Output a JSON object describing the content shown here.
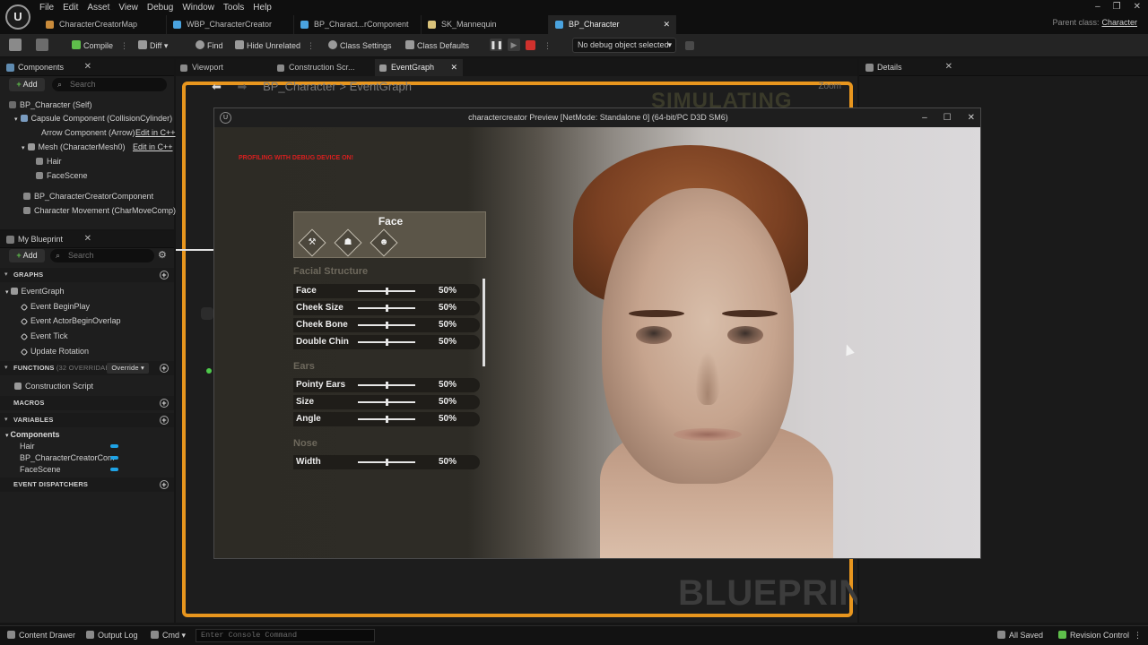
{
  "menu": [
    "File",
    "Edit",
    "Asset",
    "View",
    "Debug",
    "Window",
    "Tools",
    "Help"
  ],
  "app_logo": "U",
  "window_controls": [
    "–",
    "❐",
    "✕"
  ],
  "doc_tabs": [
    {
      "label": "CharacterCreatorMap",
      "color": "#c98b3b"
    },
    {
      "label": "WBP_CharacterCreator",
      "color": "#4aa3df"
    },
    {
      "label": "BP_Charact...rComponent",
      "color": "#4aa3df"
    },
    {
      "label": "SK_Mannequin",
      "color": "#d9c27a"
    },
    {
      "label": "BP_Character",
      "color": "#4aa3df"
    }
  ],
  "doc_tab_close": "✕",
  "parent_class": {
    "label": "Parent class:",
    "value": "Character"
  },
  "toolbar": {
    "compile": "Compile",
    "diff": "Diff",
    "find": "Find",
    "hide_unrelated": "Hide Unrelated",
    "class_settings": "Class Settings",
    "class_defaults": "Class Defaults",
    "debug_object": "No debug object selected"
  },
  "components_panel": {
    "title": "Components",
    "add": "Add",
    "search_placeholder": "Search",
    "items": [
      {
        "label": "BP_Character (Self)"
      },
      {
        "label": "Capsule Component (CollisionCylinder)"
      },
      {
        "label": "Arrow Component (Arrow)",
        "link": "Edit in C++"
      },
      {
        "label": "Mesh (CharacterMesh0)",
        "link": "Edit in C++"
      },
      {
        "label": "Hair"
      },
      {
        "label": "FaceScene"
      },
      {
        "label": "BP_CharacterCreatorComponent"
      },
      {
        "label": "Character Movement (CharMoveComp)"
      }
    ]
  },
  "my_blueprint": {
    "title": "My Blueprint",
    "add": "Add",
    "search_placeholder": "Search",
    "graphs_header": "GRAPHS",
    "graphs": [
      "EventGraph",
      "Event BeginPlay",
      "Event ActorBeginOverlap",
      "Event Tick",
      "Update Rotation"
    ],
    "functions_header": "FUNCTIONS",
    "functions_sub": "(32 OVERRIDABLE)",
    "override": "Override",
    "functions": [
      "Construction Script"
    ],
    "macros_header": "MACROS",
    "variables_header": "VARIABLES",
    "variables_group": "Components",
    "variables": [
      "Hair",
      "BP_CharacterCreatorCom",
      "FaceScene"
    ],
    "dispatchers_header": "EVENT DISPATCHERS"
  },
  "graph_tabs": [
    "Viewport",
    "Construction Scr...",
    "EventGraph"
  ],
  "breadcrumb": {
    "root": "BP_Character",
    "sep": ">",
    "current": "EventGraph"
  },
  "graph_zoom": "Zoom",
  "simulating": "SIMULATING",
  "blueprint_watermark": "BLUEPRINT",
  "details_panel": {
    "title": "Details"
  },
  "preview": {
    "title": "charactercreator Preview [NetMode: Standalone 0]  (64-bit/PC D3D SM6)",
    "logo": "U",
    "controls": [
      "–",
      "☐",
      "✕"
    ],
    "profiling": "PROFILING WITH DEBUG DEVICE ON!"
  },
  "face_panel": {
    "title": "Face",
    "category_icons": [
      "wrench-icon",
      "hat-icon",
      "head-icon"
    ],
    "category_glyphs": [
      "⚒",
      "☗",
      "☻"
    ],
    "sections": [
      {
        "name": "Facial Structure",
        "rows": [
          {
            "label": "Face",
            "value": 0.5,
            "pct": "50%"
          },
          {
            "label": "Cheek Size",
            "value": 0.5,
            "pct": "50%"
          },
          {
            "label": "Cheek Bone",
            "value": 0.5,
            "pct": "50%"
          },
          {
            "label": "Double Chin",
            "value": 0.5,
            "pct": "50%"
          }
        ]
      },
      {
        "name": "Ears",
        "rows": [
          {
            "label": "Pointy Ears",
            "value": 0.5,
            "pct": "50%"
          },
          {
            "label": "Size",
            "value": 0.5,
            "pct": "50%"
          },
          {
            "label": "Angle",
            "value": 0.5,
            "pct": "50%"
          }
        ]
      },
      {
        "name": "Nose",
        "rows": [
          {
            "label": "Width",
            "value": 0.5,
            "pct": "50%"
          }
        ]
      }
    ]
  },
  "statusbar": {
    "content_drawer": "Content Drawer",
    "output_log": "Output Log",
    "cmd": "Cmd",
    "console_placeholder": "Enter Console Command",
    "all_saved": "All Saved",
    "revision_control": "Revision Control"
  },
  "colors": {
    "accent_orange": "#e8961e",
    "add_green": "#5fbf4b",
    "variable_blue": "#1fa3e6",
    "stop_red": "#d0312d"
  }
}
